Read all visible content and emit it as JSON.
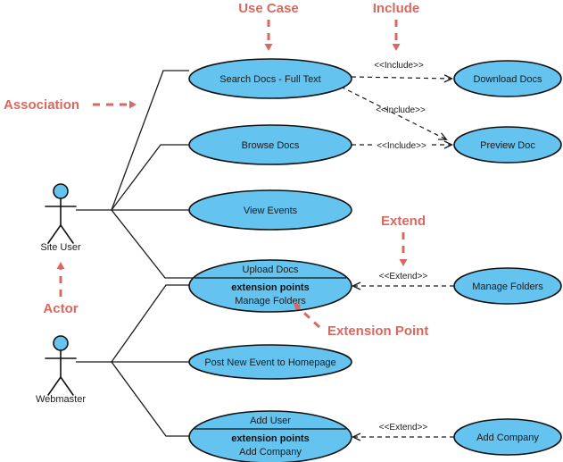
{
  "diagram": {
    "kind": "uml-use-case-diagram",
    "colors": {
      "use_case_fill": "#64c3ef",
      "use_case_stroke": "#111111",
      "annotation": "#d9695f",
      "line": "#1a1a1a",
      "background": "#ffffff"
    }
  },
  "actors": [
    {
      "id": "site-user",
      "label": "Site User"
    },
    {
      "id": "webmaster",
      "label": "Webmaster"
    }
  ],
  "use_cases": [
    {
      "id": "search-docs",
      "label": "Search Docs - Full Text"
    },
    {
      "id": "browse-docs",
      "label": "Browse Docs"
    },
    {
      "id": "view-events",
      "label": "View Events"
    },
    {
      "id": "upload-docs",
      "label": "Upload Docs",
      "extension_points_header": "extension points",
      "extension_points": "Manage Folders"
    },
    {
      "id": "post-new-event",
      "label": "Post New Event to Homepage"
    },
    {
      "id": "add-user",
      "label": "Add User",
      "extension_points_header": "extension points",
      "extension_points": "Add Company"
    },
    {
      "id": "download-docs",
      "label": "Download Docs"
    },
    {
      "id": "preview-doc",
      "label": "Preview Doc"
    },
    {
      "id": "manage-folders",
      "label": "Manage Folders"
    },
    {
      "id": "add-company",
      "label": "Add Company"
    }
  ],
  "relationships": [
    {
      "id": "include-search-download",
      "stereotype": "<<Include>>",
      "from": "search-docs",
      "to": "download-docs"
    },
    {
      "id": "include-search-preview",
      "stereotype": "<<Include>>",
      "from": "search-docs",
      "to": "preview-doc"
    },
    {
      "id": "include-browse-preview",
      "stereotype": "<<Include>>",
      "from": "browse-docs",
      "to": "preview-doc"
    },
    {
      "id": "extend-managefolders-upload",
      "stereotype": "<<Extend>>",
      "from": "manage-folders",
      "to": "upload-docs"
    },
    {
      "id": "extend-addcompany-adduser",
      "stereotype": "<<Extend>>",
      "from": "add-company",
      "to": "add-user"
    }
  ],
  "annotations": [
    {
      "id": "use-case",
      "label": "Use Case"
    },
    {
      "id": "include",
      "label": "Include"
    },
    {
      "id": "association",
      "label": "Association"
    },
    {
      "id": "actor",
      "label": "Actor"
    },
    {
      "id": "extend",
      "label": "Extend"
    },
    {
      "id": "extension-point",
      "label": "Extension Point"
    }
  ]
}
